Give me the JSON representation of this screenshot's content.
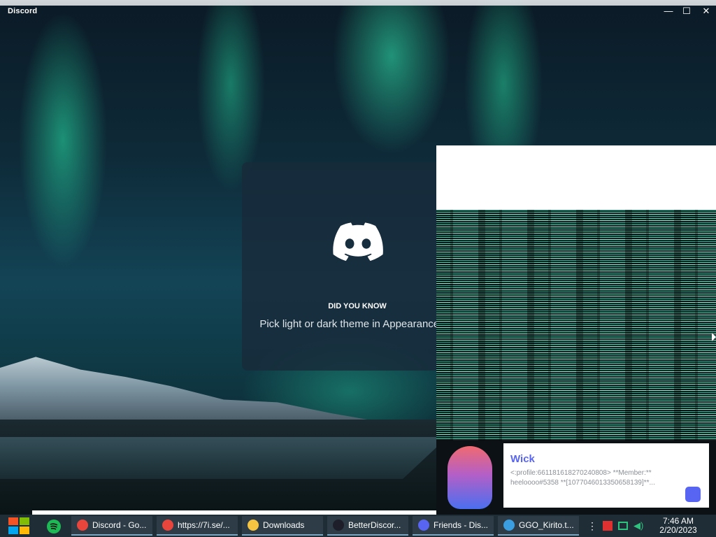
{
  "window": {
    "title": "Discord",
    "controls": {
      "minimize": "—",
      "maximize": "☐",
      "close": "✕"
    }
  },
  "loading": {
    "did_you_know_label": "DID YOU KNOW",
    "tip_text": "Pick light or dark theme in Appearance Settings."
  },
  "notification": {
    "user": "Wick",
    "message_line1": "<:profile:661181618270240808> **Member:**",
    "message_line2": "heeloooo#5358 **[1077046013350658139]**..."
  },
  "taskbar": {
    "items": [
      {
        "label": "Discord - Go...",
        "icon": "chrome-icon",
        "color": "#e8453c"
      },
      {
        "label": "https://7i.se/...",
        "icon": "chrome-icon",
        "color": "#e8453c"
      },
      {
        "label": "Downloads",
        "icon": "folder-icon",
        "color": "#f5c542"
      },
      {
        "label": "BetterDiscor...",
        "icon": "app-icon",
        "color": "#1e1e2a"
      },
      {
        "label": "Friends - Dis...",
        "icon": "discord-icon",
        "color": "#5865f2"
      },
      {
        "label": "GGO_Kirito.t...",
        "icon": "file-icon",
        "color": "#3a9ee0"
      }
    ],
    "clock": {
      "time": "7:46 AM",
      "date": "2/20/2023"
    }
  },
  "colors": {
    "accent": "#5865f2",
    "taskbar": "#1f2d36"
  }
}
